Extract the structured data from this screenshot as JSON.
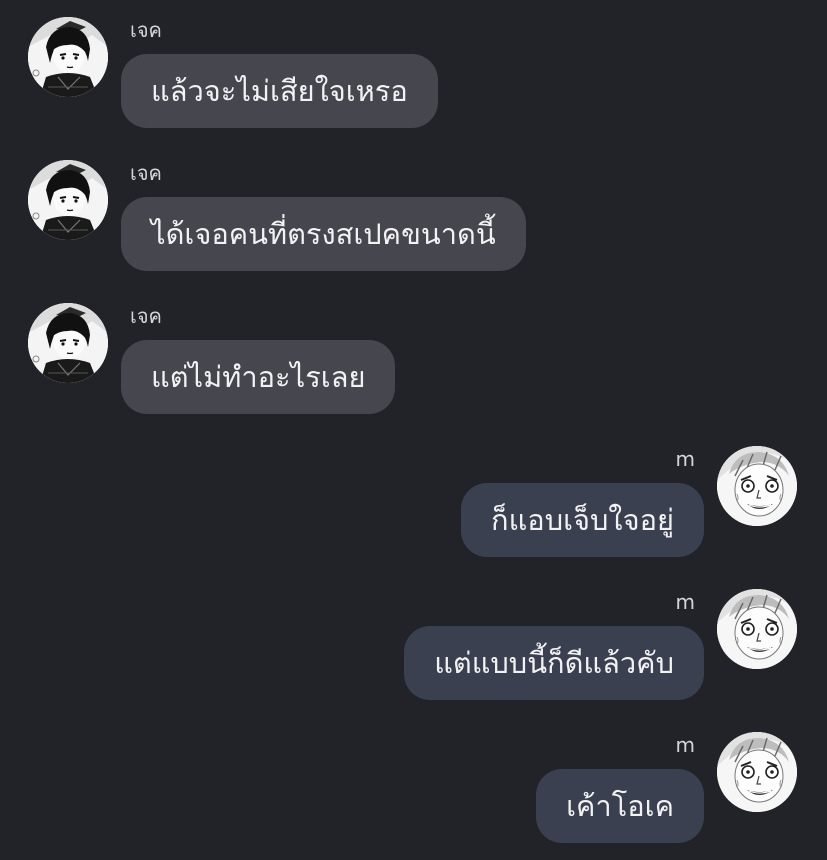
{
  "conversation": {
    "messages": [
      {
        "sender": "เจค",
        "text": "แล้วจะไม่เสียใจเหรอ",
        "direction": "incoming",
        "avatar": "avatar-jake-manga"
      },
      {
        "sender": "เจค",
        "text": "ได้เจอคนที่ตรงสเปคขนาดนี้",
        "direction": "incoming",
        "avatar": "avatar-jake-manga"
      },
      {
        "sender": "เจค",
        "text": "แต่ไม่ทำอะไรเลย",
        "direction": "incoming",
        "avatar": "avatar-jake-manga"
      },
      {
        "sender": "m",
        "text": "ก็แอบเจ็บใจอยู่",
        "direction": "outgoing",
        "avatar": "avatar-m-manga"
      },
      {
        "sender": "m",
        "text": "แต่แบบนี้ก็ดีแล้วคับ",
        "direction": "outgoing",
        "avatar": "avatar-m-manga"
      },
      {
        "sender": "m",
        "text": "เค้าโอเค",
        "direction": "outgoing",
        "avatar": "avatar-m-manga"
      }
    ]
  },
  "colors": {
    "background": "#222329",
    "incoming_bubble": "#45464e",
    "outgoing_bubble": "#3b4050",
    "text": "#f2f2f4",
    "name": "#d4d5da"
  }
}
